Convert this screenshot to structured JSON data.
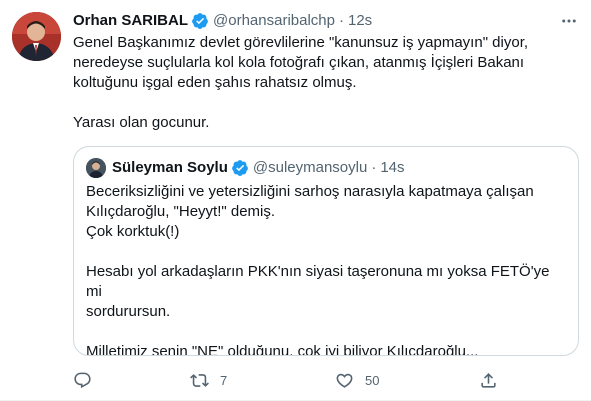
{
  "tweet": {
    "author": {
      "display_name": "Orhan SARIBAL",
      "handle": "@orhansaribalchp",
      "verified": true,
      "avatar": "profile-photo"
    },
    "time": "12s",
    "dot": "·",
    "lines": [
      "Genel Başkanımız devlet görevlilerine \"kanunsuz iş yapmayın\" diyor,",
      "neredeyse suçlularla kol kola fotoğrafı çıkan, atanmış İçişleri Bakanı",
      "koltuğunu işgal eden şahıs rahatsız olmuş.",
      "",
      "Yarası olan gocunur."
    ]
  },
  "quoted": {
    "author": {
      "display_name": "Süleyman Soylu",
      "handle": "@suleymansoylu",
      "verified": true,
      "avatar": "profile-photo"
    },
    "time": "14s",
    "dot": "·",
    "lines": [
      "Beceriksizliğini ve yetersizliğini sarhoş narasıyla kapatmaya çalışan",
      "Kılıçdaroğlu, \"Heyyt!\" demiş.",
      "Çok korktuk(!)",
      "",
      "Hesabı yol arkadaşların PKK'nın siyasi taşeronuna mı yoksa FETÖ'ye mi",
      "sordurursun.",
      "",
      "Milletimiz senin \"NE\" olduğunu, çok iyi biliyor Kılıçdaroğlu..."
    ]
  },
  "actions": {
    "reply": {
      "icon": "reply-icon",
      "count": ""
    },
    "retweet": {
      "icon": "retweet-icon",
      "count": "7"
    },
    "like": {
      "icon": "heart-icon",
      "count": "50"
    },
    "share": {
      "icon": "share-icon",
      "count": ""
    }
  },
  "colors": {
    "text": "#0f1419",
    "secondary": "#536471",
    "verified": "#1d9bf0",
    "border": "#cfd9de"
  }
}
